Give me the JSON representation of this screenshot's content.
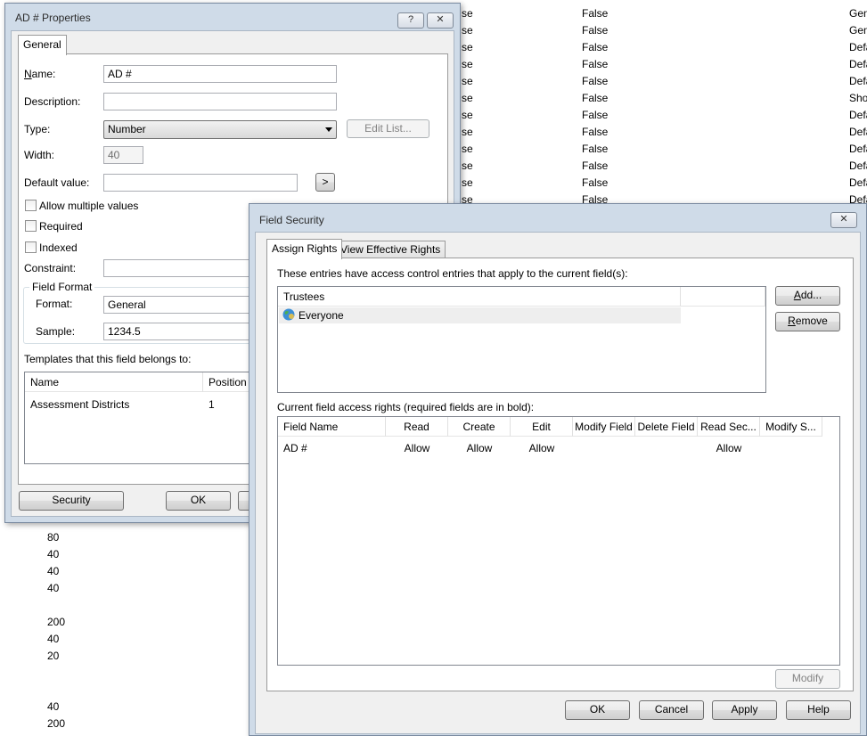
{
  "background": {
    "col_se": [
      "se",
      "se",
      "se",
      "se",
      "se",
      "se",
      "se",
      "se",
      "se",
      "se",
      "se",
      "se"
    ],
    "col_false": [
      "False",
      "False",
      "False",
      "False",
      "False",
      "False",
      "False",
      "False",
      "False",
      "False",
      "False",
      "False"
    ],
    "col_right": [
      "Gen",
      "Gen",
      "Defa",
      "Defa",
      "Defa",
      "Sho",
      "Defa",
      "Defa",
      "Defa",
      "Defa",
      "Defa",
      "Defa"
    ],
    "col_bottom": [
      "80",
      "40",
      "40",
      "40",
      "",
      "200",
      "40",
      "20",
      "",
      "",
      "40",
      "200"
    ]
  },
  "props_dialog": {
    "title": "AD # Properties",
    "help_btn": "?",
    "close_btn": "✕",
    "tab_general": "General",
    "name_label": "Name:",
    "name_value": "AD #",
    "description_label": "Description:",
    "description_value": "",
    "type_label": "Type:",
    "type_value": "Number",
    "edit_list_btn": "Edit List...",
    "width_label": "Width:",
    "width_value": "40",
    "default_label": "Default value:",
    "default_value": "",
    "default_btn": ">",
    "allow_multiple": "Allow multiple values",
    "required": "Required",
    "indexed": "Indexed",
    "constraint_label": "Constraint:",
    "field_format_label": "Field Format",
    "format_label": "Format:",
    "format_value": "General",
    "sample_label": "Sample:",
    "sample_value": "1234.5",
    "templates_label": "Templates that this field belongs to:",
    "templates_cols": [
      "Name",
      "Position"
    ],
    "templates_rows": [
      [
        "Assessment Districts",
        "1"
      ]
    ],
    "security_btn": "Security",
    "ok_btn": "OK"
  },
  "security_dialog": {
    "title": "Field Security",
    "close_btn": "✕",
    "tab_assign": "Assign Rights",
    "tab_effective": "View Effective Rights",
    "entries_label": "These entries have access control entries that apply to the current field(s):",
    "trustees_header": "Trustees",
    "trustees": [
      "Everyone"
    ],
    "add_btn": "Add...",
    "remove_btn": "Remove",
    "rights_label": "Current field access rights (required fields are in bold):",
    "rights_columns": [
      "Field Name",
      "Read",
      "Create",
      "Edit",
      "Modify Field",
      "Delete Field",
      "Read Sec...",
      "Modify S..."
    ],
    "rights_rows": [
      [
        "AD #",
        "Allow",
        "Allow",
        "Allow",
        "",
        "",
        "Allow",
        ""
      ]
    ],
    "modify_btn": "Modify",
    "ok_btn": "OK",
    "cancel_btn": "Cancel",
    "apply_btn": "Apply",
    "help_btn": "Help"
  }
}
